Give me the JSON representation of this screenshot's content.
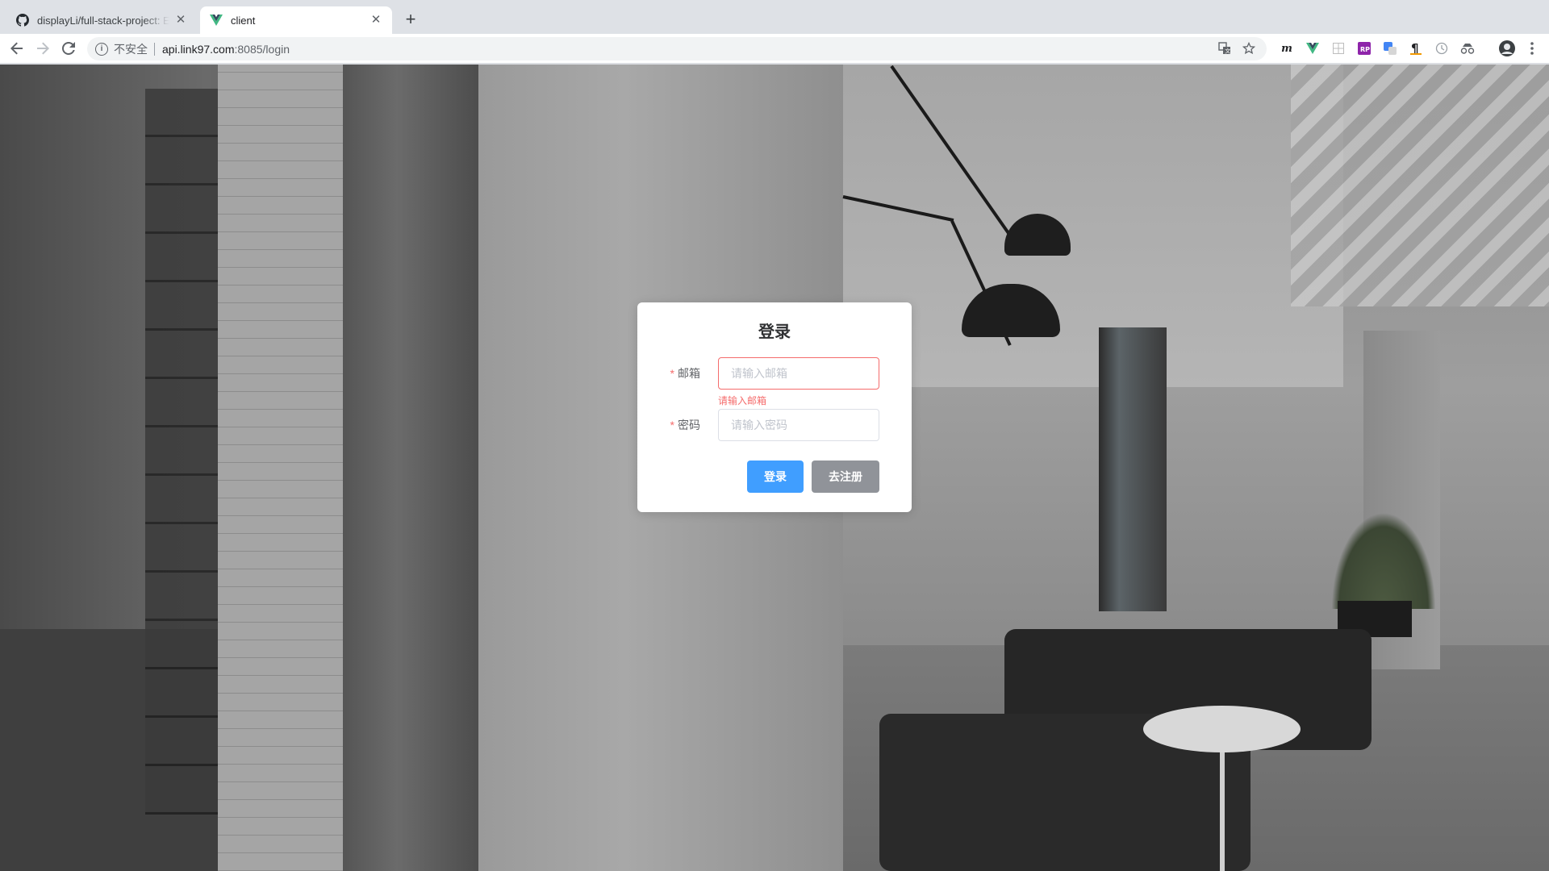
{
  "browser": {
    "tabs": [
      {
        "title": "displayLi/full-stack-project: Ex",
        "icon": "github-icon"
      },
      {
        "title": "client",
        "icon": "vue-icon"
      }
    ],
    "new_tab": "+",
    "url": {
      "security": "不安全",
      "host": "api.link97.com",
      "path": ":8085/login"
    }
  },
  "form": {
    "title": "登录",
    "email": {
      "label": "邮箱",
      "placeholder": "请输入邮箱",
      "error": "请输入邮箱"
    },
    "password": {
      "label": "密码",
      "placeholder": "请输入密码"
    },
    "required_mark": "*",
    "login_button": "登录",
    "register_button": "去注册"
  },
  "colors": {
    "primary": "#409eff",
    "info": "#909399",
    "danger": "#f56c6c"
  }
}
